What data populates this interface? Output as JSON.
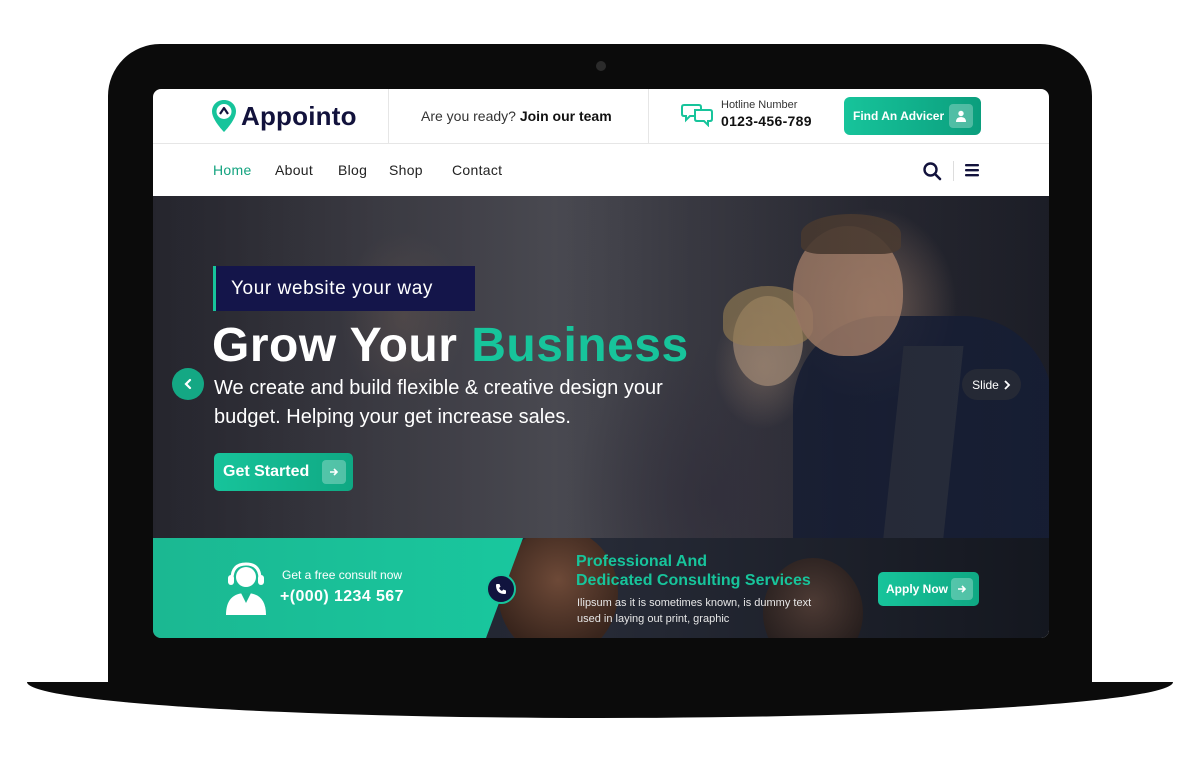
{
  "brand": {
    "name": "Appointo",
    "accent": "#17c49b",
    "navy": "#12123c"
  },
  "topbar": {
    "join_prefix": "Are you ready?",
    "join_link": "Join our team",
    "hotline_label": "Hotline Number",
    "hotline_phone": "0123-456-789",
    "cta_label": "Find An Advicer",
    "cta_icon": "user-icon"
  },
  "nav": {
    "items": [
      {
        "label": "Home",
        "active": true
      },
      {
        "label": "About",
        "active": false
      },
      {
        "label": "Blog",
        "active": false
      },
      {
        "label": "Shop",
        "active": false
      },
      {
        "label": "Contact",
        "active": false
      }
    ],
    "search_icon": "search-icon",
    "menu_icon": "hamburger-menu-icon"
  },
  "hero": {
    "tag": "Your website your way",
    "title_main": "Grow Your",
    "title_accent": "Business",
    "subtitle": "We create and build flexible & creative design your budget. Helping your get increase sales.",
    "button_label": "Get Started",
    "next_label": "Slide"
  },
  "consult": {
    "label": "Get a free consult now",
    "phone": "+(000) 1234 567",
    "title_line1": "Professional And",
    "title_line2": "Dedicated Consulting Services",
    "description": "Ilipsum as it is sometimes known, is dummy text used in laying out print, graphic",
    "button_label": "Apply Now"
  }
}
